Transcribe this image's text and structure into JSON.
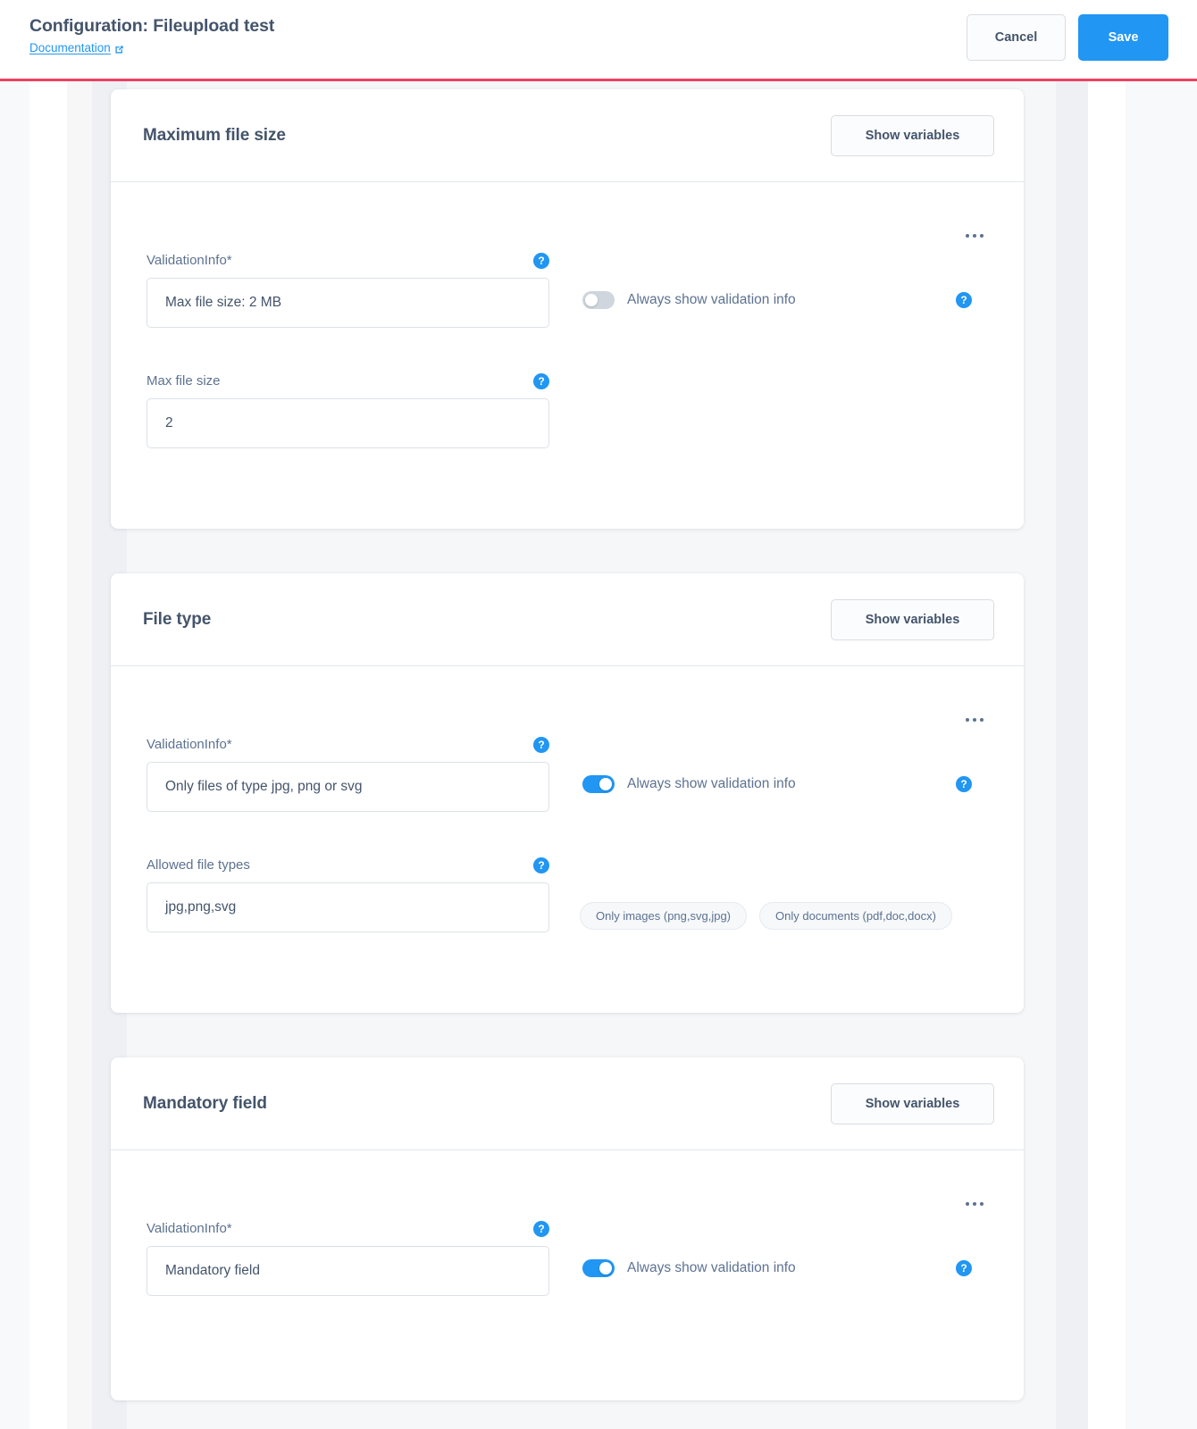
{
  "header": {
    "title": "Configuration: Fileupload test",
    "doc_link": "Documentation",
    "doc_link_icon": "external-link-icon",
    "cancel_label": "Cancel",
    "save_label": "Save",
    "accent_color": "#2196f3",
    "rule_color": "#ef4060"
  },
  "common": {
    "show_variables_label": "Show variables",
    "help_icon_glyph": "?",
    "kebab_icon": "more-options-icon",
    "toggle_label": "Always show validation info",
    "validation_info_label": "ValidationInfo*"
  },
  "cards": [
    {
      "id": "maximum-file-size",
      "title": "Maximum file size",
      "show_variables_label": "Show variables",
      "validation_info": {
        "label": "ValidationInfo*",
        "value": "Max file size: 2 MB"
      },
      "second_field": {
        "label": "Max file size",
        "value": "2"
      },
      "toggle": {
        "label": "Always show validation info",
        "state": "off"
      },
      "chips": []
    },
    {
      "id": "file-type",
      "title": "File type",
      "show_variables_label": "Show variables",
      "validation_info": {
        "label": "ValidationInfo*",
        "value": "Only files of type jpg, png or svg"
      },
      "second_field": {
        "label": "Allowed file types",
        "value": "jpg,png,svg"
      },
      "toggle": {
        "label": "Always show validation info",
        "state": "on"
      },
      "chips": [
        "Only images (png,svg,jpg)",
        "Only documents (pdf,doc,docx)"
      ]
    },
    {
      "id": "mandatory-field",
      "title": "Mandatory field",
      "show_variables_label": "Show variables",
      "validation_info": {
        "label": "ValidationInfo*",
        "value": "Mandatory field"
      },
      "second_field": null,
      "toggle": {
        "label": "Always show validation info",
        "state": "on"
      },
      "chips": []
    }
  ]
}
